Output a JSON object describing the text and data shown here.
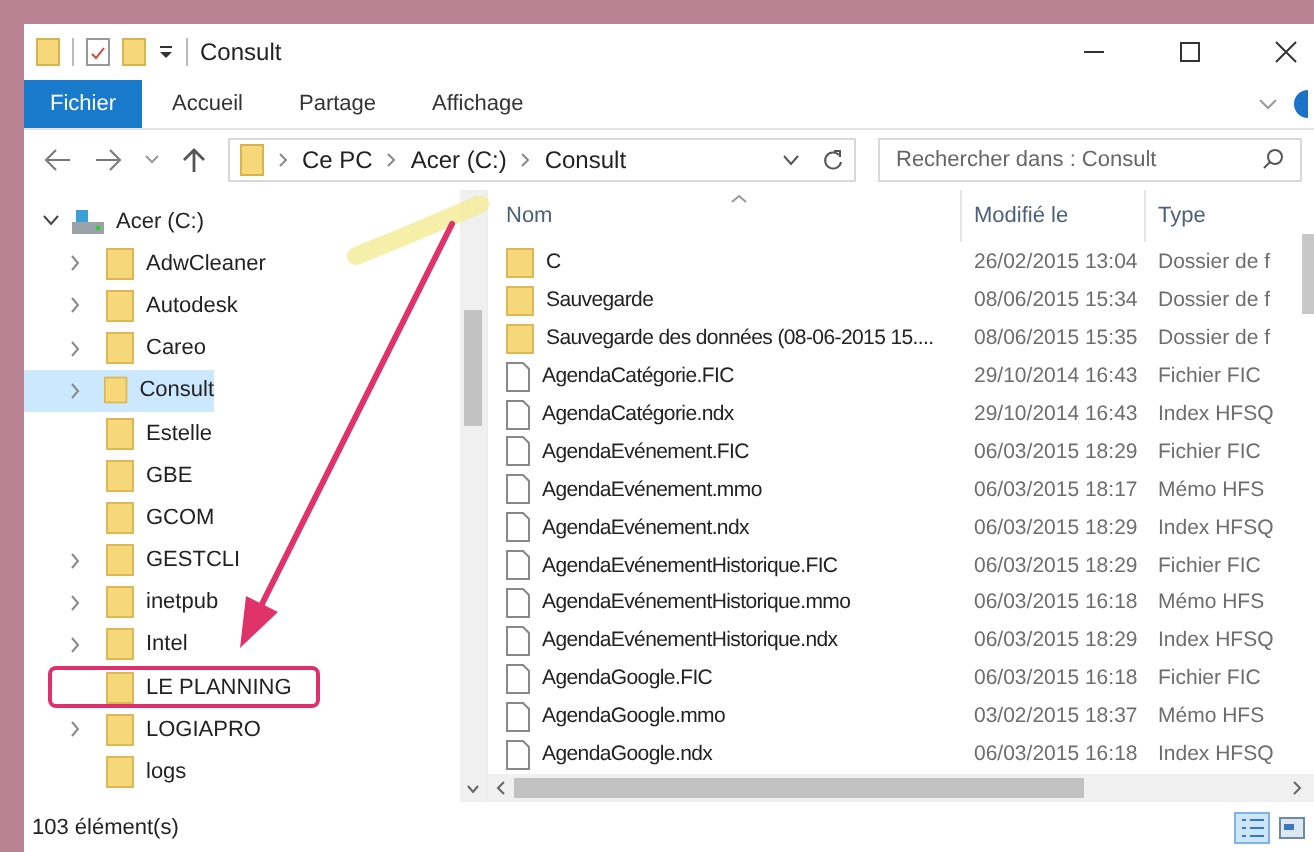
{
  "window": {
    "title": "Consult"
  },
  "ribbon_tabs": [
    {
      "label": "Fichier",
      "selected": true
    },
    {
      "label": "Accueil",
      "selected": false
    },
    {
      "label": "Partage",
      "selected": false
    },
    {
      "label": "Affichage",
      "selected": false
    }
  ],
  "breadcrumb": [
    "Ce PC",
    "Acer (C:)",
    "Consult"
  ],
  "search": {
    "placeholder": "Rechercher dans : Consult"
  },
  "navigation": {
    "label": "Acer (C:)",
    "expanded": true,
    "children": [
      {
        "label": "AdwCleaner",
        "has_children": true,
        "selected": false,
        "highlighted": false
      },
      {
        "label": "Autodesk",
        "has_children": true,
        "selected": false,
        "highlighted": false
      },
      {
        "label": "Careo",
        "has_children": true,
        "selected": false,
        "highlighted": false
      },
      {
        "label": "Consult",
        "has_children": true,
        "selected": true,
        "highlighted": false
      },
      {
        "label": "Estelle",
        "has_children": false,
        "selected": false,
        "highlighted": false
      },
      {
        "label": "GBE",
        "has_children": false,
        "selected": false,
        "highlighted": false
      },
      {
        "label": "GCOM",
        "has_children": false,
        "selected": false,
        "highlighted": false
      },
      {
        "label": "GESTCLI",
        "has_children": true,
        "selected": false,
        "highlighted": false
      },
      {
        "label": "inetpub",
        "has_children": true,
        "selected": false,
        "highlighted": false
      },
      {
        "label": "Intel",
        "has_children": true,
        "selected": false,
        "highlighted": false
      },
      {
        "label": "LE PLANNING",
        "has_children": false,
        "selected": false,
        "highlighted": true
      },
      {
        "label": "LOGIAPRO",
        "has_children": true,
        "selected": false,
        "highlighted": false
      },
      {
        "label": "logs",
        "has_children": false,
        "selected": false,
        "highlighted": false
      }
    ]
  },
  "table": {
    "columns": [
      "Nom",
      "Modifié le",
      "Type"
    ],
    "rows": [
      {
        "kind": "folder",
        "name": "C",
        "modified": "26/02/2015 13:04",
        "type": "Dossier de f"
      },
      {
        "kind": "folder",
        "name": "Sauvegarde",
        "modified": "08/06/2015 15:34",
        "type": "Dossier de f"
      },
      {
        "kind": "folder",
        "name": "Sauvegarde des données (08-06-2015 15....",
        "modified": "08/06/2015 15:35",
        "type": "Dossier de f"
      },
      {
        "kind": "file",
        "name": "AgendaCatégorie.FIC",
        "modified": "29/10/2014 16:43",
        "type": "Fichier FIC"
      },
      {
        "kind": "file",
        "name": "AgendaCatégorie.ndx",
        "modified": "29/10/2014 16:43",
        "type": "Index HFSQ"
      },
      {
        "kind": "file",
        "name": "AgendaEvénement.FIC",
        "modified": "06/03/2015 18:29",
        "type": "Fichier FIC"
      },
      {
        "kind": "file",
        "name": "AgendaEvénement.mmo",
        "modified": "06/03/2015 18:17",
        "type": "Mémo HFS"
      },
      {
        "kind": "file",
        "name": "AgendaEvénement.ndx",
        "modified": "06/03/2015 18:29",
        "type": "Index HFSQ"
      },
      {
        "kind": "file",
        "name": "AgendaEvénementHistorique.FIC",
        "modified": "06/03/2015 18:29",
        "type": "Fichier FIC"
      },
      {
        "kind": "file",
        "name": "AgendaEvénementHistorique.mmo",
        "modified": "06/03/2015 16:18",
        "type": "Mémo HFS"
      },
      {
        "kind": "file",
        "name": "AgendaEvénementHistorique.ndx",
        "modified": "06/03/2015 18:29",
        "type": "Index HFSQ"
      },
      {
        "kind": "file",
        "name": "AgendaGoogle.FIC",
        "modified": "06/03/2015 16:18",
        "type": "Fichier FIC"
      },
      {
        "kind": "file",
        "name": "AgendaGoogle.mmo",
        "modified": "03/02/2015 18:37",
        "type": "Mémo HFS"
      },
      {
        "kind": "file",
        "name": "AgendaGoogle.ndx",
        "modified": "06/03/2015 16:18",
        "type": "Index HFSQ"
      }
    ]
  },
  "status_bar": {
    "count": "103 élément(s)"
  }
}
